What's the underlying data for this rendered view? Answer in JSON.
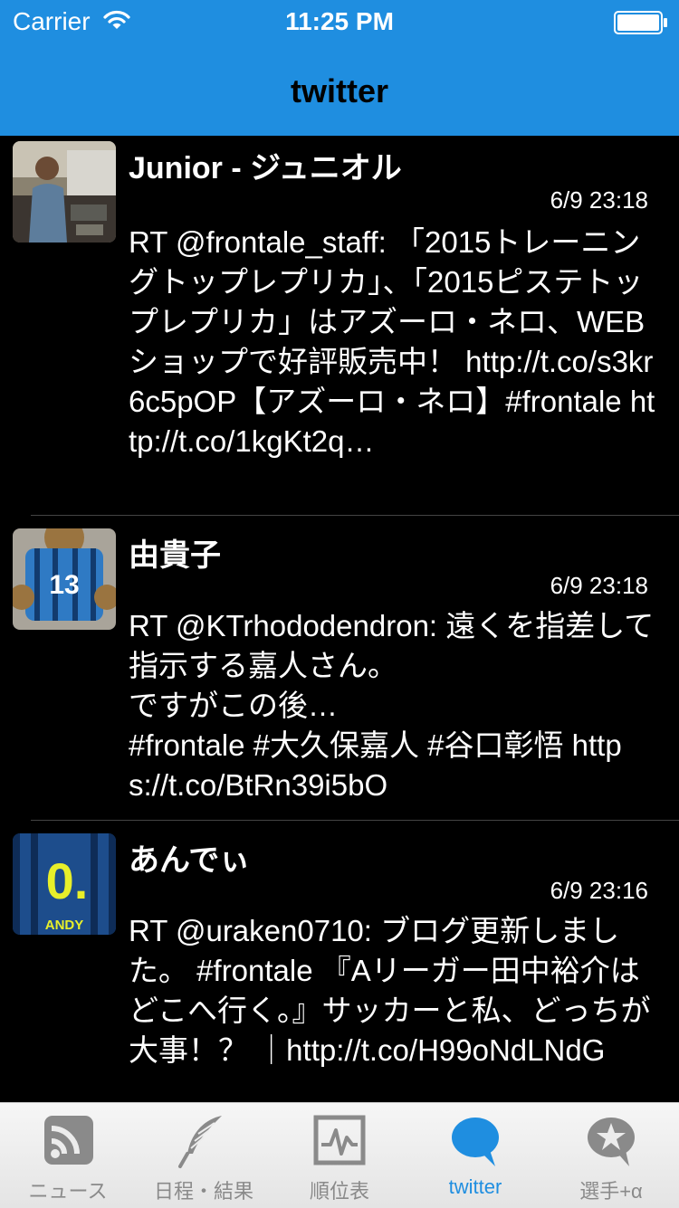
{
  "status_bar": {
    "carrier": "Carrier",
    "time": "11:25 PM"
  },
  "nav": {
    "title": "twitter"
  },
  "tweets": [
    {
      "name": "Junior - ジュニオル",
      "time": "6/9 23:18",
      "text": "RT @frontale_staff: 「2015トレーニングトップレプリカ」、「2015ピステトップレプリカ」はアズーロ・ネロ、WEBショップで好評販売中！ http://t.co/s3kr6c5pOP【アズーロ・ネロ】#frontale http://t.co/1kgKt2q…",
      "avatar": "avatar-photo"
    },
    {
      "name": "由貴子",
      "time": "6/9 23:18",
      "text": "RT @KTrhododendron: 遠くを指差して指示する嘉人さん。\nですがこの後…\n#frontale #大久保嘉人 #谷口彰悟 https://t.co/BtRn39i5bO",
      "avatar": "avatar-bear",
      "avatar_number": "13"
    },
    {
      "name": "あんでぃ",
      "time": "6/9 23:16",
      "text": "RT @uraken0710: ブログ更新しました。 #frontale 『Aリーガー田中裕介はどこへ行く。』サッカーと私、どっちが大事！？ ｜http://t.co/H99oNdLNdG",
      "avatar": "avatar-jersey",
      "avatar_number": "0.",
      "avatar_caption": "ANDY"
    }
  ],
  "tabs": [
    {
      "label": "ニュース",
      "icon": "rss-icon",
      "active": false
    },
    {
      "label": "日程・結果",
      "icon": "feather-icon",
      "active": false
    },
    {
      "label": "順位表",
      "icon": "chart-icon",
      "active": false
    },
    {
      "label": "twitter",
      "icon": "speech-bubble-icon",
      "active": true
    },
    {
      "label": "選手+α",
      "icon": "star-bubble-icon",
      "active": false
    }
  ],
  "colors": {
    "accent": "#1f8ee0",
    "tab_inactive": "#8a8a8a",
    "background": "#000000"
  }
}
